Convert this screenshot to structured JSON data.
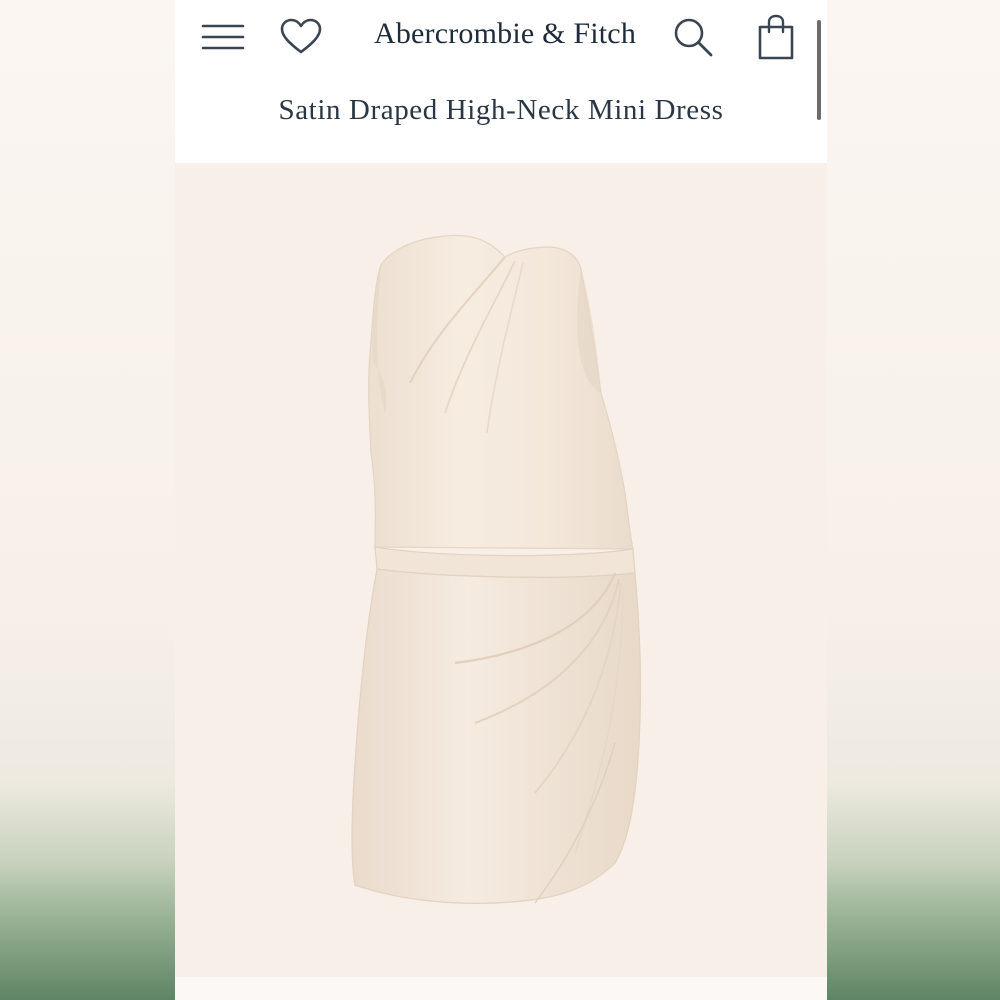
{
  "header": {
    "brand": "Abercrombie & Fitch",
    "menu_icon": "hamburger-menu-icon",
    "wishlist_icon": "heart-icon",
    "search_icon": "search-icon",
    "bag_icon": "shopping-bag-icon"
  },
  "product": {
    "title": "Satin Draped High-Neck Mini Dress",
    "image_subject": "dress-image"
  },
  "colors": {
    "brand_text": "#1e2b3a",
    "dress": "#f4e8db",
    "background": "#f7efe8",
    "icon": "#3a4552"
  }
}
